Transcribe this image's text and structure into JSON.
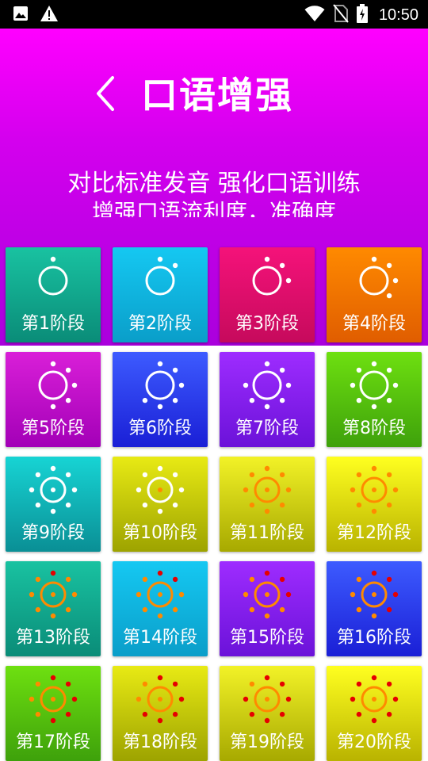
{
  "status_bar": {
    "time": "10:50",
    "left_icons": [
      "image-icon",
      "warning-icon"
    ],
    "right_icons": [
      "wifi-icon",
      "no-sim-icon",
      "battery-charging-icon"
    ]
  },
  "header": {
    "title": "口语增强",
    "subtitle": "对比标准发音 强化口语训练",
    "subtitle2": "增强口语流利度，准确度"
  },
  "stages": [
    {
      "label": "第1阶段",
      "colors": [
        "#19c2a1",
        "#0a8c78"
      ],
      "icon": "sun-icon"
    },
    {
      "label": "第2阶段",
      "colors": [
        "#15c8f2",
        "#0a9ec9"
      ],
      "icon": "sun-icon"
    },
    {
      "label": "第3阶段",
      "colors": [
        "#f5127a",
        "#c60a5c"
      ],
      "icon": "sun-icon"
    },
    {
      "label": "第4阶段",
      "colors": [
        "#ff8a00",
        "#e05d00"
      ],
      "icon": "sun-icon"
    },
    {
      "label": "第5阶段",
      "colors": [
        "#d91fd8",
        "#a300b7"
      ],
      "icon": "sun-icon"
    },
    {
      "label": "第6阶段",
      "colors": [
        "#3d5bff",
        "#1a1fd6"
      ],
      "icon": "sun-icon"
    },
    {
      "label": "第7阶段",
      "colors": [
        "#9e2cff",
        "#6b12d9"
      ],
      "icon": "sun-icon"
    },
    {
      "label": "第8阶段",
      "colors": [
        "#6ee010",
        "#3ea10b"
      ],
      "icon": "sun-icon"
    },
    {
      "label": "第9阶段",
      "colors": [
        "#17d4d4",
        "#0a8f95"
      ],
      "icon": "sun-icon"
    },
    {
      "label": "第10阶段",
      "colors": [
        "#e8ea14",
        "#9da300"
      ],
      "icon": "sun-icon"
    },
    {
      "label": "第11阶段",
      "colors": [
        "#f2f227",
        "#a7a900"
      ],
      "icon": "sun-icon"
    },
    {
      "label": "第12阶段",
      "colors": [
        "#ffff20",
        "#b9b300"
      ],
      "icon": "sun-icon"
    },
    {
      "label": "第13阶段",
      "colors": [
        "#19c2a1",
        "#0a8c78"
      ],
      "icon": "sun-icon"
    },
    {
      "label": "第14阶段",
      "colors": [
        "#15c8f2",
        "#0a9ec9"
      ],
      "icon": "sun-icon"
    },
    {
      "label": "第15阶段",
      "colors": [
        "#9e2cff",
        "#6b12d9"
      ],
      "icon": "sun-icon"
    },
    {
      "label": "第16阶段",
      "colors": [
        "#3d5bff",
        "#1a1fd6"
      ],
      "icon": "sun-icon"
    },
    {
      "label": "第17阶段",
      "colors": [
        "#6ee010",
        "#3ea10b"
      ],
      "icon": "sun-icon"
    },
    {
      "label": "第18阶段",
      "colors": [
        "#e8ea14",
        "#9da300"
      ],
      "icon": "sun-icon"
    },
    {
      "label": "第19阶段",
      "colors": [
        "#f2f227",
        "#a7a900"
      ],
      "icon": "sun-icon"
    },
    {
      "label": "第20阶段",
      "colors": [
        "#ffff20",
        "#b9b300"
      ],
      "icon": "sun-icon"
    }
  ]
}
